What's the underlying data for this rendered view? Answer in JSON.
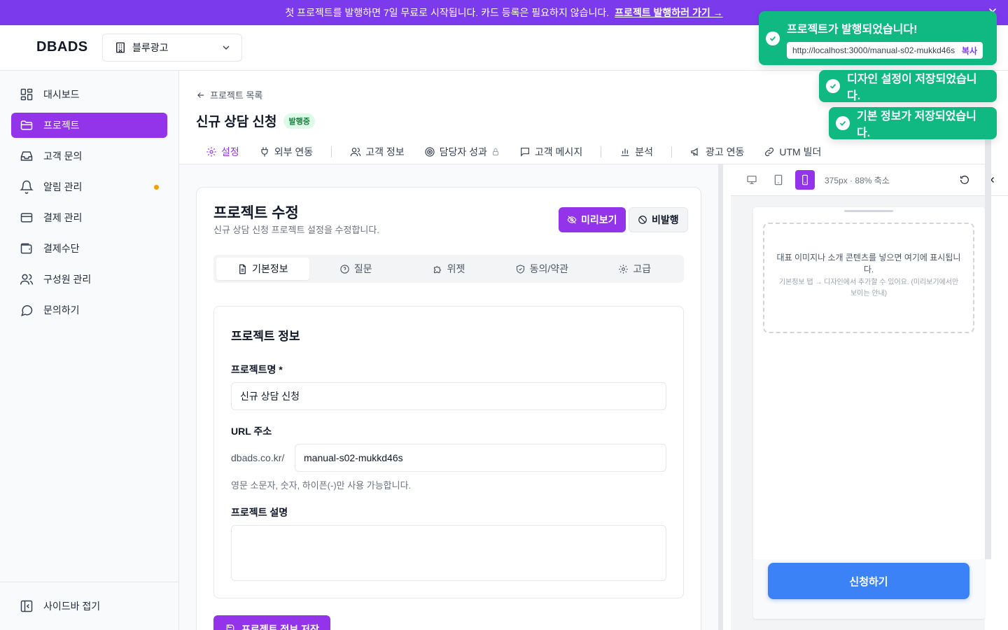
{
  "banner": {
    "text": "첫 프로젝트를 발행하면 7일 무료로 시작됩니다. 카드 등록은 필요하지 않습니다.",
    "link": "프로젝트 발행하러 가기 →"
  },
  "header": {
    "logo": "DBADS",
    "org": "블루광고"
  },
  "sidebar": {
    "items": [
      {
        "label": "대시보드",
        "icon": "dashboard-icon"
      },
      {
        "label": "프로젝트",
        "icon": "folder-icon"
      },
      {
        "label": "고객 문의",
        "icon": "inbox-icon"
      },
      {
        "label": "알림 관리",
        "icon": "bell-icon"
      },
      {
        "label": "결제 관리",
        "icon": "credit-card-icon"
      },
      {
        "label": "결제수단",
        "icon": "wallet-icon"
      },
      {
        "label": "구성원 관리",
        "icon": "users-icon"
      },
      {
        "label": "문의하기",
        "icon": "chat-bubble-icon"
      }
    ],
    "collapse": "사이드바 접기",
    "active_color": "#9333ea",
    "notification_dot_color": "#f59e0b"
  },
  "page": {
    "back": "프로젝트 목록",
    "title": "신규 상담 신청",
    "status": "발행중",
    "tabs": [
      "설정",
      "외부 연동",
      "고객 정보",
      "담당자 성과",
      "고객 메시지",
      "분석",
      "광고 연동",
      "UTM 빌더"
    ]
  },
  "card": {
    "title": "프로젝트 수정",
    "subtitle": "신규 상담 신청 프로젝트 설정을 수정합니다.",
    "preview_btn": "미리보기",
    "unpublish_btn": "비발행",
    "subtabs": [
      "기본정보",
      "질문",
      "위젯",
      "동의/약관",
      "고급"
    ],
    "section_title": "프로젝트 정보",
    "name_label": "프로젝트명 *",
    "name_value": "신규 상담 신청",
    "url_label": "URL 주소",
    "url_prefix": "dbads.co.kr/",
    "url_value": "manual-s02-mukkd46s",
    "url_hint": "영문 소문자, 숫자, 하이픈(-)만 사용 가능합니다.",
    "desc_label": "프로젝트 설명",
    "desc_value": "",
    "save_btn": "프로젝트 정보 저장"
  },
  "preview": {
    "size": "375px · 88% 축소",
    "placeholder_main": "대표 이미지나 소개 콘텐츠를 넣으면 여기에 표시됩니다.",
    "placeholder_sub": "기본정보 탭 → 디자인에서 추가할 수 있어요. (미리보기에서만 보이는 안내)",
    "cta": "신청하기",
    "cta_color": "#3b82f6"
  },
  "toasts": {
    "published": "프로젝트가 발행되었습니다!",
    "url": "http://localhost:3000/manual-s02-mukkd46s",
    "copy": "복사",
    "design_saved": "디자인 설정이 저장되었습니다.",
    "basic_saved": "기본 정보가 저장되었습니다.",
    "color": "#10b981"
  }
}
